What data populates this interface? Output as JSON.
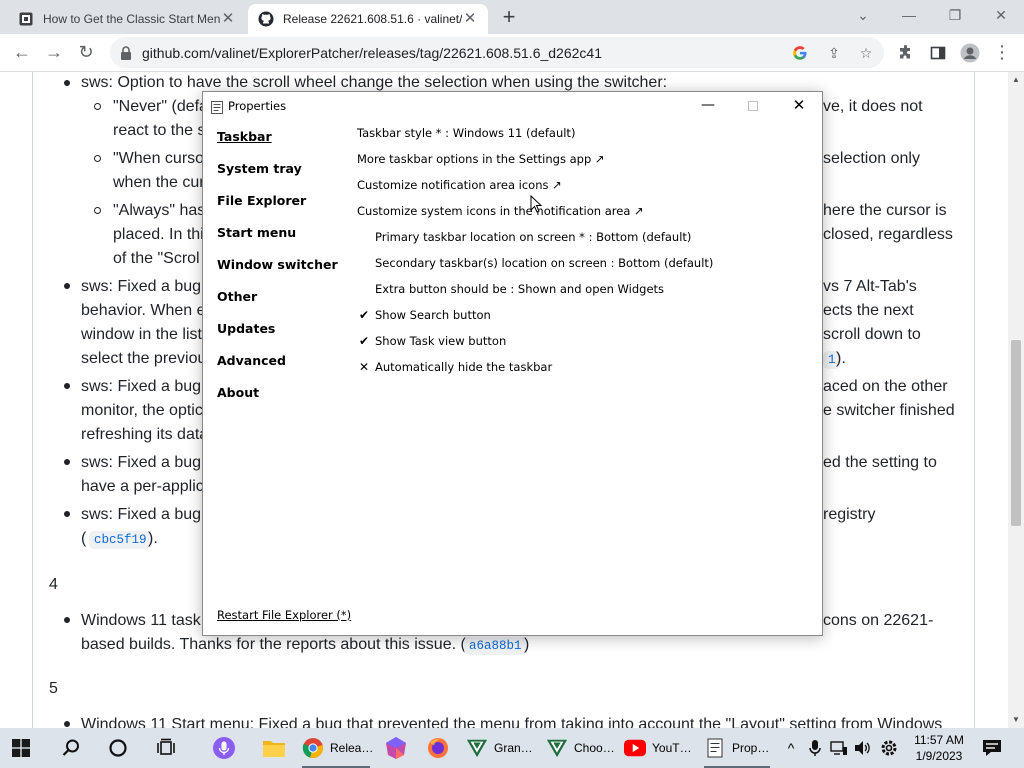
{
  "browser": {
    "tabs": [
      {
        "title": "How to Get the Classic Start Menu",
        "active": false
      },
      {
        "title": "Release 22621.608.51.6 · valinet/",
        "active": true
      }
    ],
    "url": "github.com/valinet/ExplorerPatcher/releases/tag/22621.608.51.6_d262c41"
  },
  "page": {
    "lines": [
      "sws: Option to have the scroll wheel change the selection when using the switcher:",
      "\"Never\" (defa",
      "ve, it does not",
      "react to the s",
      "\"When curso",
      "selection only",
      "when the cur",
      "\"Always\" has",
      "here the cursor is",
      "placed. In thi",
      "closed, regardless",
      "of the \"Scrol",
      "sws: Fixed a bug",
      "vs 7 Alt-Tab's",
      "behavior. When e",
      "ects the next",
      "window in the list",
      "scroll down to",
      "select the previou",
      "1",
      ").",
      "sws: Fixed a bug",
      "aced on the other",
      "monitor, the optic",
      "e switcher finished",
      "refreshing its data",
      "sws: Fixed a bug",
      "ed the setting to",
      "have a per-applic",
      "sws: Fixed a bug",
      "registry",
      "(",
      "cbc5f19",
      ").",
      "4",
      "Windows 11 task",
      "cons on 22621-",
      "based builds. Thanks for the reports about this issue. (",
      "a6a88b1",
      ")",
      "5",
      "Windows 11 Start menu: Fixed a bug that prevented the menu from taking into account the \"Layout\" setting from Windows"
    ]
  },
  "dialog": {
    "title": "Properties",
    "nav": [
      "Taskbar",
      "System tray",
      "File Explorer",
      "Start menu",
      "Window switcher",
      "Other",
      "Updates",
      "Advanced",
      "About"
    ],
    "options": [
      "Taskbar style * : Windows 11 (default)",
      "More taskbar options in the Settings app ↗",
      "Customize notification area icons ↗",
      "Customize system icons in the notification area ↗",
      "Primary taskbar location on screen * : Bottom (default)",
      "Secondary taskbar(s) location on screen : Bottom (default)",
      "Extra button should be : Shown and open Widgets",
      "Show Search button",
      "Show Task view button",
      "Automatically hide the taskbar"
    ],
    "marks": [
      "✔",
      "✔",
      "✕"
    ],
    "restart": "Restart File Explorer (*)"
  },
  "taskbar": {
    "apps": [
      "Relea…",
      "Gran…",
      "Choo…",
      "YouT…",
      "Prop…"
    ],
    "time": "11:57 AM",
    "date": "1/9/2023"
  },
  "colors": {
    "tabbar": "#dee1e6",
    "taskbar": "#dde3ea",
    "link_code": "#0969da"
  },
  "icons": [
    "github-icon",
    "lock-icon",
    "google-icon",
    "share-icon",
    "star-icon",
    "extensions-icon",
    "sidepanel-icon",
    "profile-icon",
    "menu-icon",
    "windows-start-icon",
    "search-icon",
    "cortana-icon",
    "taskview-icon",
    "microphone-icon",
    "file-explorer-icon",
    "chrome-icon",
    "firefox-icon",
    "youtube-icon",
    "settings-icon",
    "notifications-icon"
  ]
}
